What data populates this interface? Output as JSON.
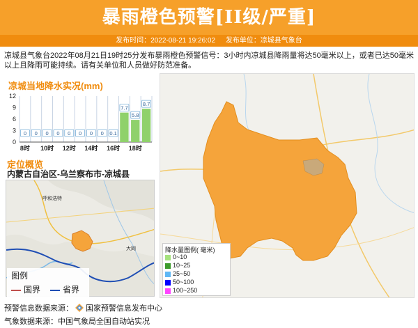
{
  "header": {
    "title": "暴雨橙色预警[II级/严重]",
    "publish_time_label": "发布时间：2022-08-21 19:26:02",
    "publish_unit_label": "发布单位：凉城县气象台"
  },
  "description": "凉城县气象台2022年08月21日19时25分发布暴雨橙色预警信号：3小时内凉城县降雨量将达50毫米以上，或者已达50毫米以上且降雨可能持续。请有关单位和人员做好防范准备。",
  "rain_panel": {
    "title": "凉城当地降水实况(mm)"
  },
  "chart_data": {
    "type": "bar",
    "categories": [
      "8时",
      "9时",
      "10时",
      "11时",
      "12时",
      "13时",
      "14时",
      "15时",
      "16时",
      "17时",
      "18时",
      "19时"
    ],
    "x_tick_labels": [
      "8时",
      "10时",
      "12时",
      "14时",
      "16时",
      "18时"
    ],
    "values": [
      0,
      0,
      0,
      0,
      0,
      0,
      0,
      0,
      0.1,
      7.7,
      5.8,
      8.7
    ],
    "value_labels": [
      "0",
      "0",
      "0",
      "0",
      "0",
      "0",
      "0",
      "0",
      "0.1",
      "7.7",
      "5.8",
      "8.7"
    ],
    "y_ticks": [
      0,
      3,
      6,
      9,
      12
    ],
    "ylim": [
      0,
      12
    ],
    "bar_color": "#8fd16b",
    "title": "凉城当地降水实况(mm)",
    "xlabel": "",
    "ylabel": ""
  },
  "location": {
    "title": "定位概览",
    "path": "内蒙古自治区-乌兰察布市-凉城县",
    "map_labels": {
      "city": "呼和浩特",
      "town": "大同"
    },
    "legend_title": "图例",
    "legend_items": [
      {
        "label": "国界",
        "color": "#c0504d"
      },
      {
        "label": "省界",
        "color": "#1f4eb4"
      }
    ]
  },
  "rain_legend": {
    "title": "降水量图例( 毫米)",
    "items": [
      {
        "label": "0~10",
        "color": "#a6e27d"
      },
      {
        "label": "10~25",
        "color": "#3c9b2a"
      },
      {
        "label": "25~50",
        "color": "#5fb8f5"
      },
      {
        "label": "50~100",
        "color": "#0000ff"
      },
      {
        "label": "100~250",
        "color": "#ff44ff"
      }
    ]
  },
  "colors": {
    "warning_orange": "#f6a02a",
    "alert_region": "#f5a43b"
  },
  "footer": {
    "warning_source": "预警信息数据来源：",
    "warning_source_name": "国家预警信息发布中心",
    "weather_source": "气象数据来源：中国气象局全国自动站实况"
  }
}
